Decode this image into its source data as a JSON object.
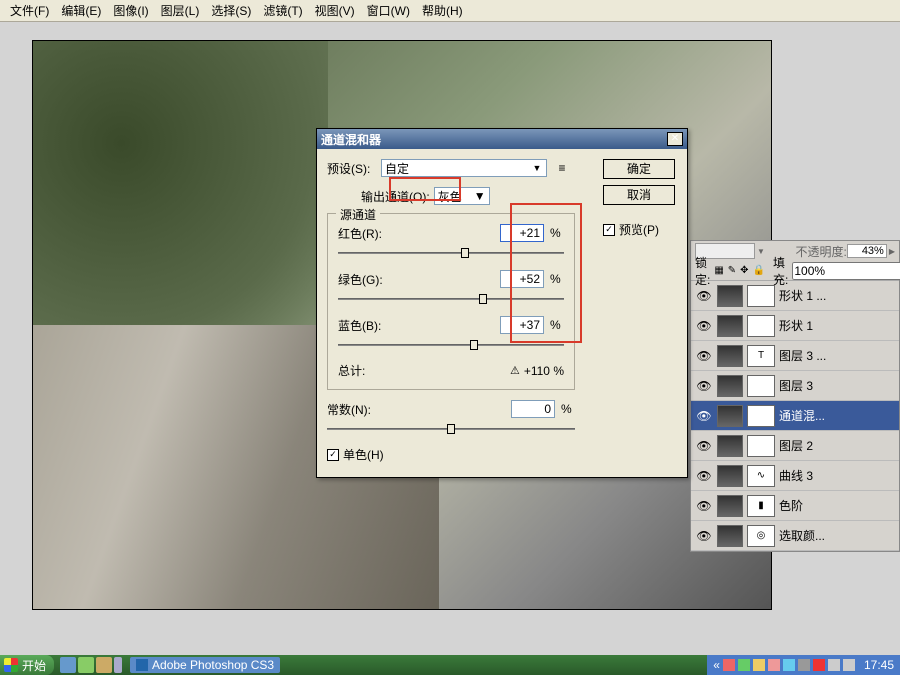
{
  "menu": [
    "文件(F)",
    "编辑(E)",
    "图像(I)",
    "图层(L)",
    "选择(S)",
    "滤镜(T)",
    "视图(V)",
    "窗口(W)",
    "帮助(H)"
  ],
  "dialog": {
    "title": "通道混和器",
    "close": "✕",
    "preset_label": "预设(S):",
    "preset_value": "自定",
    "ok": "确定",
    "cancel": "取消",
    "preview_label": "预览(P)",
    "output_label": "输出通道(O):",
    "output_value": "灰色",
    "source_legend": "源通道",
    "red_label": "红色(R):",
    "red_value": "+21",
    "green_label": "绿色(G):",
    "green_value": "+52",
    "blue_label": "蓝色(B):",
    "blue_value": "+37",
    "pct": "%",
    "total_label": "总计:",
    "total_value": "+110 %",
    "warn": "⚠",
    "const_label": "常数(N):",
    "const_value": "0",
    "mono_label": "单色(H)"
  },
  "layers": {
    "opacity_label": "不透明度:",
    "opacity_value": "43%",
    "fill_label": "填充:",
    "fill_value": "100%",
    "lock_label": "锁定:",
    "items": [
      {
        "name": "形状 1 ...",
        "icon": ""
      },
      {
        "name": "形状 1",
        "icon": ""
      },
      {
        "name": "图层 3 ...",
        "icon": "T"
      },
      {
        "name": "图层 3",
        "icon": ""
      },
      {
        "name": "通道混...",
        "icon": "◐",
        "sel": true
      },
      {
        "name": "图层 2",
        "icon": ""
      },
      {
        "name": "曲线 3",
        "icon": "∿"
      },
      {
        "name": "色阶",
        "icon": "▮"
      },
      {
        "name": "选取颜...",
        "icon": "◎"
      }
    ]
  },
  "taskbar": {
    "start": "开始",
    "app": "Adobe Photoshop CS3",
    "time": "17:45"
  }
}
